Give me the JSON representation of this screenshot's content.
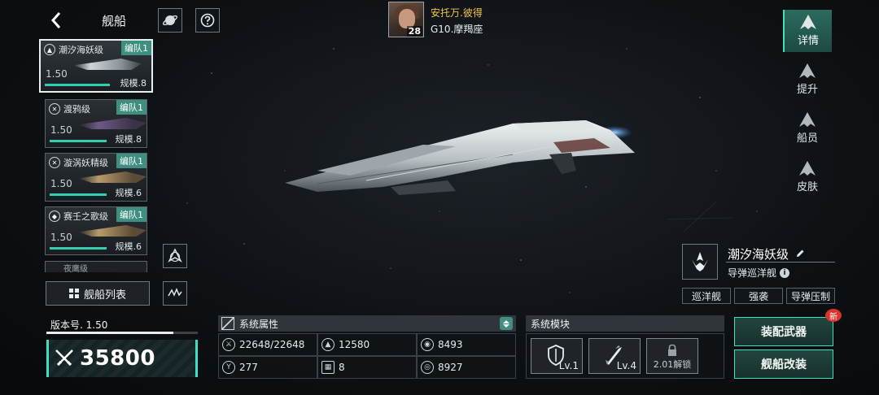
{
  "header": {
    "back_icon": "back-arrow-icon",
    "title": "舰船",
    "planet_icon": "planet-icon",
    "help_icon": "question-icon"
  },
  "commander": {
    "name": "安托万.彼得",
    "zodiac": "G10.摩羯座",
    "level": "28"
  },
  "ships": [
    {
      "name": "潮汐海妖级",
      "team": "编队1",
      "version": "1.50",
      "scale": "规模.8",
      "active": true
    },
    {
      "name": "渡鸦级",
      "team": "编队1",
      "version": "1.50",
      "scale": "规模.8"
    },
    {
      "name": "漩涡妖精级",
      "team": "编队1",
      "version": "1.50",
      "scale": "规模.6"
    },
    {
      "name": "赛壬之歌级",
      "team": "编队1",
      "version": "1.50",
      "scale": "规模.6"
    },
    {
      "name": "夜鹰级"
    }
  ],
  "ship_list_button": "舰船列表",
  "side_tabs": [
    {
      "label": "详情",
      "active": true
    },
    {
      "label": "提升"
    },
    {
      "label": "船员"
    },
    {
      "label": "皮肤"
    }
  ],
  "selected_ship": {
    "name": "潮汐海妖级",
    "role": "导弹巡洋舰",
    "tags": [
      "巡洋舰",
      "强袭",
      "导弹压制"
    ]
  },
  "version": {
    "label": "版本号. 1.50",
    "progress": 0.84
  },
  "power": {
    "value": "35800"
  },
  "attributes": {
    "title": "系统属性",
    "cells": [
      {
        "icon": "hull-icon",
        "value": "22648/22648"
      },
      {
        "icon": "armor-icon",
        "value": "12580"
      },
      {
        "icon": "shield-icon",
        "value": "8493"
      },
      {
        "icon": "speed-icon",
        "value": "277"
      },
      {
        "icon": "grid-icon",
        "value": "8"
      },
      {
        "icon": "target-icon",
        "value": "8927"
      }
    ]
  },
  "modules": {
    "title": "系统模块",
    "items": [
      {
        "icon": "shield-module-icon",
        "level": "Lv.1"
      },
      {
        "icon": "missile-module-icon",
        "level": "Lv.4"
      },
      {
        "icon": "lock-icon",
        "unlock": "2.01解锁"
      }
    ]
  },
  "actions": {
    "equip_weapon": "装配武器",
    "refit": "舰船改装",
    "new_badge": "新"
  },
  "colors": {
    "accent": "#3ee0c0",
    "team_tag": "#3f8f80",
    "commander_name": "#f0c64a",
    "new_badge": "#d8342c"
  }
}
